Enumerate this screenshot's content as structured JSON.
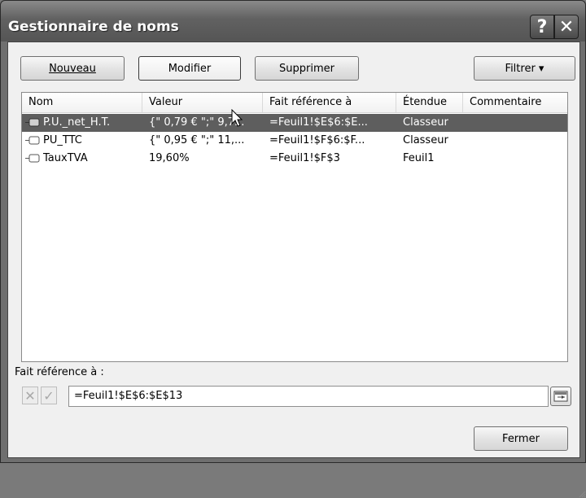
{
  "window": {
    "title": "Gestionnaire de noms"
  },
  "titlebar_buttons": {
    "help": "?",
    "close": "✕"
  },
  "toolbar": {
    "new_label": "Nouveau",
    "edit_label": "Modifier",
    "delete_label": "Supprimer",
    "filter_label": "Filtrer ▾"
  },
  "table": {
    "columns": [
      "Nom",
      "Valeur",
      "Fait référence à",
      "Étendue",
      "Commentaire"
    ],
    "rows": [
      {
        "name": "P.U._net_H.T.",
        "value": "{\" 0,79 € \";\" 9,7...",
        "ref": "=Feuil1!$E$6:$E...",
        "scope": "Classeur",
        "comment": ""
      },
      {
        "name": "PU_TTC",
        "value": "{\" 0,95 € \";\" 11,...",
        "ref": "=Feuil1!$F$6:$F...",
        "scope": "Classeur",
        "comment": ""
      },
      {
        "name": "TauxTVA",
        "value": "19,60%",
        "ref": "=Feuil1!$F$3",
        "scope": "Feuil1",
        "comment": ""
      }
    ]
  },
  "refers_to": {
    "label": "Fait référence à :",
    "value": "=Feuil1!$E$6:$E$13"
  },
  "footer": {
    "close_label": "Fermer"
  },
  "colors": {
    "selected_row": "#5e5e5e",
    "titlebar": "#616161"
  }
}
